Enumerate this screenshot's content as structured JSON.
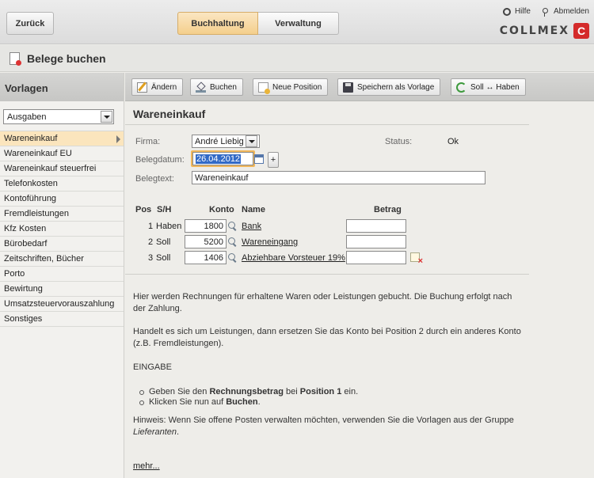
{
  "header": {
    "back_label": "Zurück",
    "tabs": [
      {
        "label": "Buchhaltung",
        "active": true
      },
      {
        "label": "Verwaltung",
        "active": false
      }
    ],
    "help_label": "Hilfe",
    "logout_label": "Abmelden",
    "logo_text": "COLLMEX",
    "logo_mark": "C"
  },
  "title": "Belege buchen",
  "sidebar": {
    "heading": "Vorlagen",
    "group_select": "Ausgaben",
    "items": [
      {
        "label": "Wareneinkauf",
        "active": true
      },
      {
        "label": "Wareneinkauf EU"
      },
      {
        "label": "Wareneinkauf steuerfrei"
      },
      {
        "label": "Telefonkosten"
      },
      {
        "label": "Kontoführung"
      },
      {
        "label": "Fremdleistungen"
      },
      {
        "label": "Kfz Kosten"
      },
      {
        "label": "Bürobedarf"
      },
      {
        "label": "Zeitschriften, Bücher"
      },
      {
        "label": "Porto"
      },
      {
        "label": "Bewirtung"
      },
      {
        "label": "Umsatzsteuervorauszahlung"
      },
      {
        "label": "Sonstiges"
      }
    ]
  },
  "toolbar": {
    "edit": "Ändern",
    "book": "Buchen",
    "new_position": "Neue Position",
    "save_template": "Speichern als Vorlage",
    "swap": "Soll ↔ Haben"
  },
  "form": {
    "heading": "Wareneinkauf",
    "firma_label": "Firma:",
    "firma_value": "André Liebig",
    "status_label": "Status:",
    "status_value": "Ok",
    "belegdatum_label": "Belegdatum:",
    "belegdatum_value": "26.04.2012",
    "plus": "+",
    "belegtext_label": "Belegtext:",
    "belegtext_value": "Wareneinkauf"
  },
  "table": {
    "headers": {
      "pos": "Pos",
      "sh": "S/H",
      "konto": "Konto",
      "name": "Name",
      "betrag": "Betrag"
    },
    "rows": [
      {
        "pos": "1",
        "sh": "Haben",
        "konto": "1800",
        "name": "Bank",
        "betrag": ""
      },
      {
        "pos": "2",
        "sh": "Soll",
        "konto": "5200",
        "name": "Wareneingang",
        "betrag": ""
      },
      {
        "pos": "3",
        "sh": "Soll",
        "konto": "1406",
        "name": "Abziehbare Vorsteuer 19%",
        "betrag": ""
      }
    ]
  },
  "help": {
    "p1": "Hier werden Rechnungen für erhaltene Waren oder Leistungen gebucht. Die Buchung erfolgt nach der Zahlung.",
    "p2": "Handelt es sich um Leistungen, dann ersetzen Sie das Konto bei Position 2 durch ein anderes Konto (z.B. Fremdleistungen).",
    "eingabe": "EINGABE",
    "b1_pre": "Geben Sie den ",
    "b1_bold1": "Rechnungsbetrag",
    "b1_mid": " bei ",
    "b1_bold2": "Position 1",
    "b1_post": " ein.",
    "b2_pre": "Klicken Sie nun auf ",
    "b2_bold": "Buchen",
    "b2_post": ".",
    "hint_pre": "Hinweis: Wenn Sie offene Posten verwalten möchten, verwenden Sie die Vorlagen aus der Gruppe ",
    "hint_em": "Lieferanten",
    "hint_post": ".",
    "more": "mehr..."
  }
}
